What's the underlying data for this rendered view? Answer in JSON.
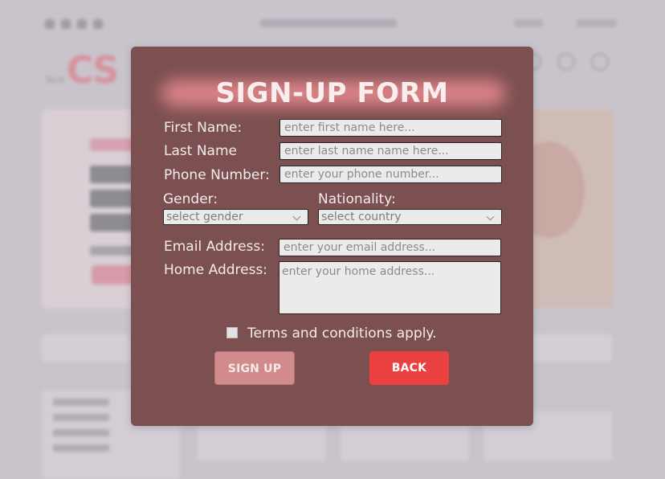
{
  "background": {
    "logo_text": "CS",
    "logo_prefix": "Tech"
  },
  "form": {
    "title": "SIGN-UP FORM",
    "first_name": {
      "label": "First Name:",
      "placeholder": "enter first name here..."
    },
    "last_name": {
      "label": "Last Name",
      "placeholder": "enter last name name here..."
    },
    "phone": {
      "label": "Phone Number:",
      "placeholder": "enter your phone number..."
    },
    "gender": {
      "label": "Gender:",
      "value": "select gender"
    },
    "nationality": {
      "label": "Nationality:",
      "value": "select country"
    },
    "email": {
      "label": "Email Address:",
      "placeholder": "enter your email address..."
    },
    "home": {
      "label": "Home Address:",
      "placeholder": "enter your home address..."
    },
    "terms": {
      "label": "Terms and conditions apply.",
      "checked": false
    },
    "signup_label": "SIGN UP",
    "back_label": "BACK"
  },
  "colors": {
    "modal_bg": "#7c4f51",
    "back_button": "#ea4040",
    "signup_button": "#d18b8d"
  }
}
